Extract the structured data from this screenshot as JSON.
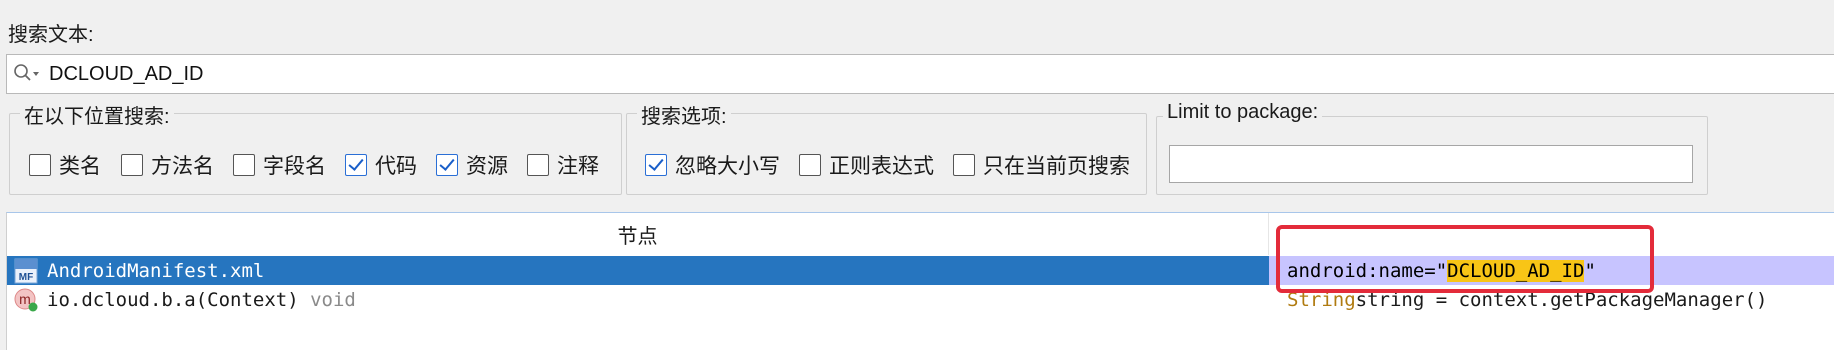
{
  "search": {
    "label": "搜索文本:",
    "value": "DCLOUD_AD_ID",
    "icon": "search-icon"
  },
  "search_in": {
    "title": "在以下位置搜索:",
    "options": [
      {
        "label": "类名",
        "checked": false
      },
      {
        "label": "方法名",
        "checked": false
      },
      {
        "label": "字段名",
        "checked": false
      },
      {
        "label": "代码",
        "checked": true
      },
      {
        "label": "资源",
        "checked": true
      },
      {
        "label": "注释",
        "checked": false
      }
    ]
  },
  "search_options": {
    "title": "搜索选项:",
    "options": [
      {
        "label": "忽略大小写",
        "checked": true
      },
      {
        "label": "正则表达式",
        "checked": false
      },
      {
        "label": "只在当前页搜索",
        "checked": false
      }
    ]
  },
  "limit_package": {
    "title": "Limit to package:",
    "value": ""
  },
  "results": {
    "column_node": "节点",
    "column_code": "",
    "rows": [
      {
        "icon": "manifest-file-icon",
        "icon_text": "MF",
        "node": "AndroidManifest.xml",
        "code_prefix": "android:name=\"",
        "code_match": "DCLOUD_AD_ID",
        "code_suffix": "\"",
        "selected": true
      },
      {
        "icon": "method-icon",
        "icon_text": "m",
        "node": "io.dcloud.b.a(Context)",
        "node_suffix": " void",
        "code_type": "String",
        "code_rest": " string = context.getPackageManager()",
        "selected": false
      }
    ]
  },
  "colors": {
    "selection": "#2675bf",
    "match_highlight": "#f8c516",
    "annotation_box": "#e32b3a"
  }
}
